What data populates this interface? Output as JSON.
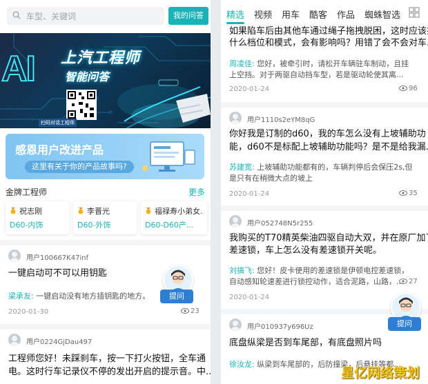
{
  "left": {
    "search": {
      "placeholder": "车型、关键词",
      "button": "我的问答"
    },
    "banner": {
      "ai": "AI",
      "title1": "上汽工程师",
      "title2": "智能问答",
      "scan_label": "扫码对话工程师"
    },
    "promo": {
      "title": "感恩用户改进产品",
      "subtitle": "这里有关于你的产品故事吗?"
    },
    "gold": {
      "title": "金牌工程师",
      "more": "更多",
      "engineers": [
        {
          "name": "祝志刚",
          "desc": "D60-内饰"
        },
        {
          "name": "李晋光",
          "desc": "D60-外饰"
        },
        {
          "name": "福禄寿小弟女...",
          "desc": "D60-D60产..."
        }
      ]
    },
    "posts": [
      {
        "user": "用户100667K47inf",
        "question": "一键启动可不可以用钥匙",
        "answerer": "梁承友:",
        "answer": "一键启动没有地方插钥匙的地方。",
        "date": "2020-01-30",
        "views": "23"
      },
      {
        "user": "用户0224GjDau497",
        "question_l1": "工程师您好！未踩刹车，按一下打火按钮，全车通",
        "question_l2": "电。这时行车记录仪不停的发出开启的提示音。中..."
      }
    ],
    "ask_label": "提问"
  },
  "right": {
    "tabs": [
      "精选",
      "视频",
      "用车",
      "酷客",
      "作品",
      "蜘蛛智选"
    ],
    "posts": [
      {
        "question_l1": "如果陷车后由其他车通过绳子拖拽脱困，这时应该挂",
        "question_l2": "什么档位和模式，会有影响吗？用错了会不会对车...",
        "answerer": "周凌佳:",
        "answer_l1": "您好，被牵引时，请松开车辆驻车制动，且挂",
        "answer_l2": "上空挡。对于两驱自动挡车型，若是驱动轮使其离...",
        "date": "2020-01-24",
        "views": "96"
      },
      {
        "user": "用户1110s2eYM8qG",
        "question_l1": "你好我是订制的d60，我的车怎么没有上坡辅助功",
        "question_l2": "能，d60不是标配上坡辅助功能吗？是不是给我漏...",
        "answerer": "苏建宽:",
        "answer_l1": "上坡辅助功能都有的，车辆判停后会保压2s,但",
        "answer_l2": "是只有在稍微大点的坡上",
        "date": "2020-01-24",
        "views": "35"
      },
      {
        "user": "用户052748N5r255",
        "question_l1": "我购买的T70精英柴油四驱自动大双，并在原厂加了",
        "question_l2": "差速锁，车上怎么没有差速锁开关呢。",
        "answerer": "刘搞飞:",
        "answer_l1": "您好！皮卡使用的差速锁是伊顿电控差速锁，",
        "answer_l2": "自动感知轮速差进行锁控动作，适合泥路，山路，...",
        "date": "2020-01-24",
        "views": "27"
      },
      {
        "user": "用户010937y696Uz",
        "question": "底盘纵梁是否到车尾部，有底盘照片吗",
        "answerer": "徐汝龙:",
        "answer": "纵梁到车尾部的，后防撞梁，后悬挂等都..."
      }
    ],
    "ask_label": "提问"
  },
  "watermark": "星亿网络策划",
  "colors": {
    "accent": "#17b3b7",
    "ask_blue": "#2e7fd3"
  }
}
